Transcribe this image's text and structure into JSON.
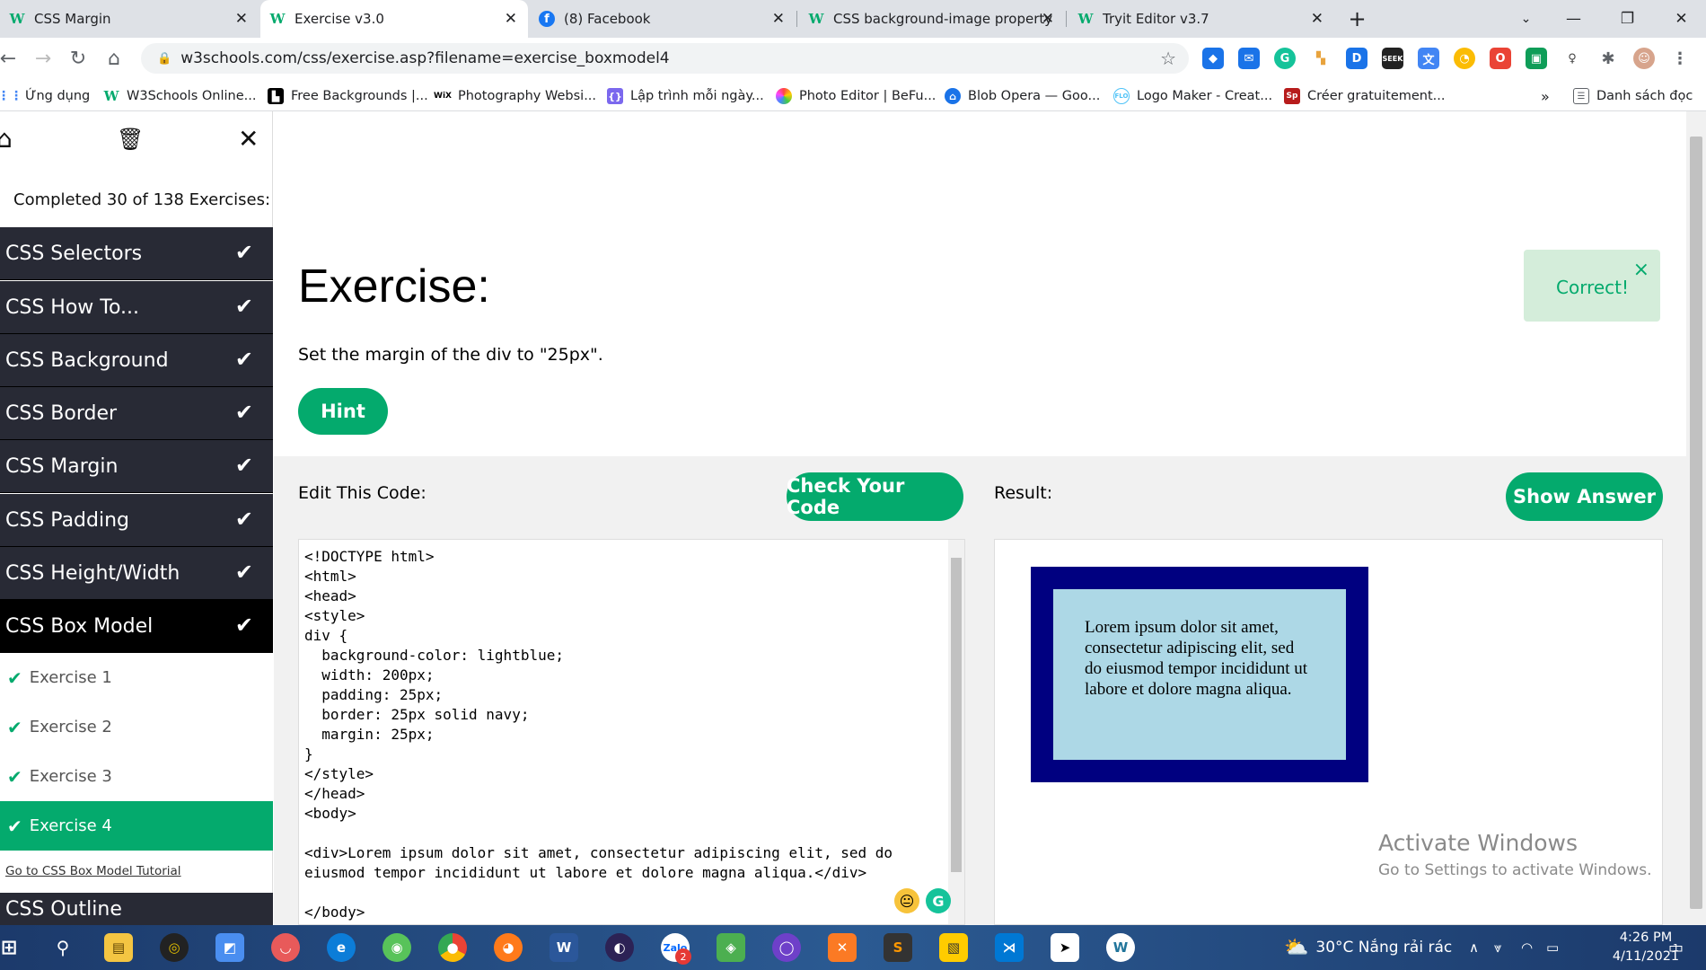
{
  "browser": {
    "tabs": [
      {
        "title": "CSS Margin",
        "icon": "w3schools-icon"
      },
      {
        "title": "Exercise v3.0",
        "icon": "w3schools-icon"
      },
      {
        "title": "(8) Facebook",
        "icon": "facebook-icon"
      },
      {
        "title": "CSS background-image property",
        "icon": "w3schools-icon"
      },
      {
        "title": "Tryit Editor v3.7",
        "icon": "w3schools-icon"
      }
    ],
    "active_tab": 1,
    "url": "w3schools.com/css/exercise.asp?filename=exercise_boxmodel4",
    "bookmarks": [
      "Ứng dụng",
      "W3Schools Online...",
      "Free Backgrounds |...",
      "Photography Websi...",
      "Lập trình mỗi ngày...",
      "Photo Editor | BeFu...",
      "Blob Opera — Goo...",
      "Logo Maker - Creat...",
      "Créer gratuitement..."
    ],
    "reading_list": "Danh sách đọc",
    "more_bookmarks": "»"
  },
  "sidebar": {
    "progress": "Completed 30 of 138 Exercises:",
    "categories": [
      "CSS Selectors",
      "CSS How To...",
      "CSS Background",
      "CSS Border",
      "CSS Margin",
      "CSS Padding",
      "CSS Height/Width",
      "CSS Box Model"
    ],
    "exercises": [
      "Exercise 1",
      "Exercise 2",
      "Exercise 3",
      "Exercise 4"
    ],
    "active_exercise": "Exercise 4",
    "tutorial_link": "Go to CSS Box Model Tutorial",
    "next_category": "CSS Outline"
  },
  "exercise": {
    "title": "Exercise:",
    "description": "Set the margin of the div to \"25px\".",
    "hint_label": "Hint",
    "correct_message": "Correct!",
    "close_symbol": "×"
  },
  "editor": {
    "label": "Edit This Code:",
    "check_label": "Check Your Code",
    "code": "<!DOCTYPE html>\n<html>\n<head>\n<style>\ndiv {\n  background-color: lightblue;\n  width: 200px;\n  padding: 25px;\n  border: 25px solid navy;\n  margin: 25px;\n}\n</style>\n</head>\n<body>\n\n<div>Lorem ipsum dolor sit amet, consectetur adipiscing elit, sed do\neiusmod tempor incididunt ut labore et dolore magna aliqua.</div>\n\n</body>"
  },
  "result": {
    "label": "Result:",
    "show_answer_label": "Show Answer",
    "content": "Lorem ipsum dolor sit amet, consectetur adipiscing elit, sed do eiusmod tempor incididunt ut labore et dolore magna aliqua."
  },
  "watermark": {
    "line1": "Activate Windows",
    "line2": "Go to Settings to activate Windows."
  },
  "taskbar": {
    "weather": "30°C  Nắng rải rác",
    "time": "4:26 PM",
    "date": "4/11/2021",
    "notification_count": "1",
    "zalo_badge": "2"
  },
  "colors": {
    "accent": "#04aa6d",
    "sidebar_dark": "#282a35",
    "correct_bg": "#d4edda",
    "navy": "#000080",
    "lightblue": "#add8e6"
  }
}
